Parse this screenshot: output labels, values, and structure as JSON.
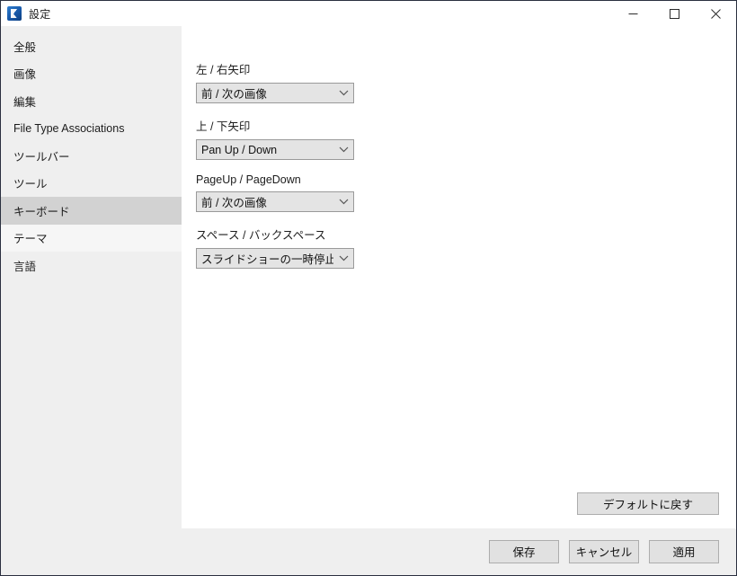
{
  "window": {
    "title": "設定",
    "icon": "app-logo-icon",
    "controls": {
      "minimize": "minimize-icon",
      "maximize": "maximize-icon",
      "close": "close-icon"
    },
    "border_color": "#2b3040"
  },
  "sidebar": {
    "selected_index": 6,
    "hover_index": 7,
    "selected_color": "#d2d2d2",
    "hover_color": "#f6f6f6",
    "background": "#efefef",
    "items": [
      {
        "label": "全般"
      },
      {
        "label": "画像"
      },
      {
        "label": "編集"
      },
      {
        "label": "File Type Associations"
      },
      {
        "label": "ツールバー"
      },
      {
        "label": "ツール"
      },
      {
        "label": "キーボード"
      },
      {
        "label": "テーマ"
      },
      {
        "label": "言語"
      }
    ]
  },
  "content": {
    "groups": [
      {
        "label": "左 / 右矢印",
        "value": "前 / 次の画像",
        "arrow_icon": "chevron-down-icon"
      },
      {
        "label": "上 / 下矢印",
        "value": "Pan Up / Down",
        "arrow_icon": "chevron-down-icon"
      },
      {
        "label": "PageUp / PageDown",
        "value": "前 / 次の画像",
        "arrow_icon": "chevron-down-icon"
      },
      {
        "label": "スペース / バックスペース",
        "value": "スライドショーの一時停止",
        "arrow_icon": "chevron-down-icon"
      }
    ],
    "restore_defaults_label": "デフォルトに戻す"
  },
  "footer": {
    "save_label": "保存",
    "cancel_label": "キャンセル",
    "apply_label": "適用"
  }
}
